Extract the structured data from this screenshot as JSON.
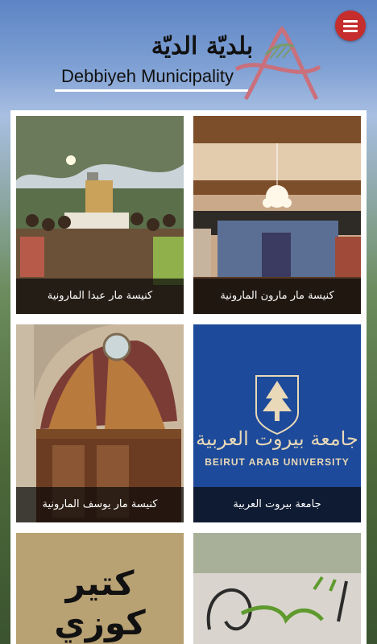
{
  "header": {
    "logo_ar": "بلديّة الديّة",
    "logo_en": "Debbiyeh Municipality",
    "menu_icon": "hamburger-menu-icon",
    "accent_color": "#c62d2d"
  },
  "tiles": [
    {
      "caption": "كنيسة مار عبدا المارونية"
    },
    {
      "caption": "كنيسة مار مارون المارونية"
    },
    {
      "caption": "كنيسة مار يوسف المارونية"
    },
    {
      "caption": "جامعة بيروت العربية",
      "logo_ar": "جامعة بيروت العربية",
      "logo_en": "BEIRUT ARAB UNIVERSITY"
    },
    {
      "caption": "",
      "sign_text": "كتير كوزي"
    },
    {
      "caption": ""
    }
  ]
}
